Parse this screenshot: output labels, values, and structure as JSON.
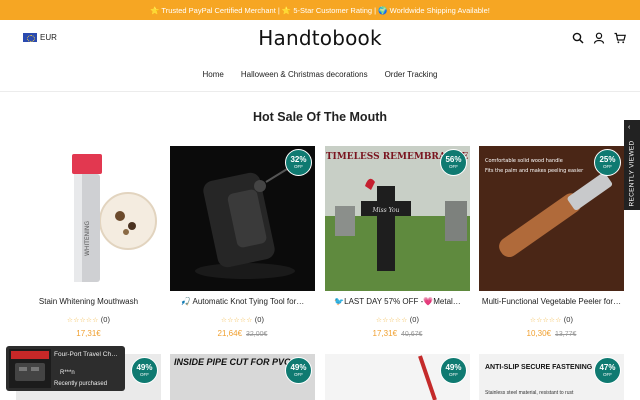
{
  "announcement": "⭐ Trusted PayPal Certified Merchant | ⭐ 5-Star Customer Rating | 🌍 Worldwide Shipping Available!",
  "header": {
    "currency": "EUR",
    "logo": "Handtobook",
    "icons": [
      "search-icon",
      "account-icon",
      "cart-icon"
    ]
  },
  "nav": {
    "items": [
      "Home",
      "Halloween & Christmas decorations",
      "Order Tracking"
    ]
  },
  "section": {
    "title": "Hot Sale Of The Mouth"
  },
  "side_tab": {
    "label": "RECENTLY VIEWED"
  },
  "products": [
    {
      "title": "Stain Whitening Mouthwash",
      "rating": "(0)",
      "price": "17,31€",
      "compare": "",
      "discount": ""
    },
    {
      "title": "🎣 Automatic Knot Tying Tool for…",
      "rating": "(0)",
      "price": "21,64€",
      "compare": "32,00€",
      "discount": "32%"
    },
    {
      "title": "🐦LAST DAY 57% OFF -💗Metal…",
      "rating": "(0)",
      "price": "17,31€",
      "compare": "40,67€",
      "discount": "56%"
    },
    {
      "title": "Multi-Functional Vegetable Peeler for…",
      "rating": "(0)",
      "price": "10,30€",
      "compare": "13,77€",
      "discount": "25%"
    }
  ],
  "products_row2": [
    {
      "discount": "49%",
      "image_text": ""
    },
    {
      "discount": "49%",
      "image_text": "INSIDE PIPE CUT FOR PVC"
    },
    {
      "discount": "49%",
      "image_text": ""
    },
    {
      "discount": "47%",
      "image_text": "ANTI-SLIP SECURE FASTENING",
      "image_subtext": "Stainless steel material, resistant to rust"
    }
  ],
  "badge_off_label": "OFF",
  "image_labels": {
    "mouthwash_bottle": "WHITENING",
    "memorial_sign": "TIMELESS REMEMBRANCE",
    "memorial_cross": "Miss You",
    "peeler_line1": "Comfortable solid wood handle",
    "peeler_line2": "Fits the palm and makes peeling easier"
  },
  "popup": {
    "title": "Four-Port Travel Ch…",
    "name": "R***n",
    "status": "Recently purchased"
  },
  "colors": {
    "announcement_bg": "#f6a623",
    "badge_bg": "#0f7a71",
    "price": "#f0a030",
    "star": "#f0b33a"
  }
}
